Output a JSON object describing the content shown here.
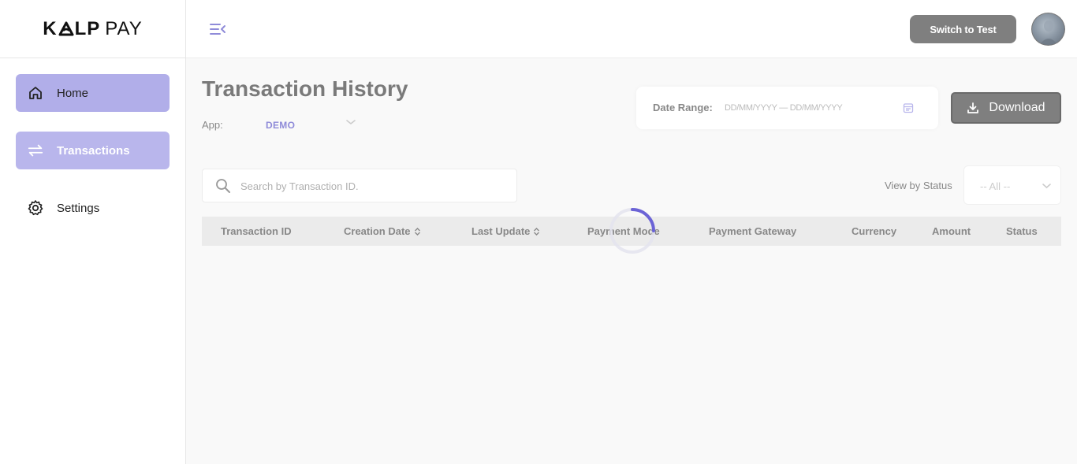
{
  "brand": {
    "logo_left": "K",
    "logo_mid": "LP",
    "logo_right": "PAY"
  },
  "sidebar": {
    "items": [
      {
        "label": "Home",
        "icon": "home-icon",
        "state": "active"
      },
      {
        "label": "Transactions",
        "icon": "transfer-arrows-icon",
        "state": "selected"
      },
      {
        "label": "Settings",
        "icon": "gear-icon",
        "state": "default"
      }
    ]
  },
  "topbar": {
    "switch_label": "Switch to Test",
    "avatar_icon": "user-avatar"
  },
  "page": {
    "title": "Transaction History",
    "app_label": "App:",
    "app_value": "DEMO"
  },
  "date_range": {
    "label": "Date Range:",
    "placeholder": "DD/MM/YYYY  —  DD/MM/YYYY"
  },
  "download": {
    "label": "Download"
  },
  "search": {
    "placeholder": "Search by Transaction ID."
  },
  "status_filter": {
    "label": "View by Status",
    "selected": "-- All --"
  },
  "table": {
    "columns": [
      {
        "label": "Transaction ID",
        "sortable": false
      },
      {
        "label": "Creation Date",
        "sortable": true
      },
      {
        "label": "Last Update",
        "sortable": true
      },
      {
        "label": "Payment Mode",
        "sortable": false
      },
      {
        "label": "Payment Gateway",
        "sortable": false
      },
      {
        "label": "Currency",
        "sortable": false
      },
      {
        "label": "Amount",
        "sortable": false
      },
      {
        "label": "Status",
        "sortable": false
      }
    ],
    "loading": true
  },
  "colors": {
    "accent": "#8f8bd9",
    "nav_home_bg": "#b1aee9",
    "nav_tx_bg": "#b9b6ec",
    "button_gray": "#7f7f7f",
    "spinner": "#6b63d6"
  }
}
